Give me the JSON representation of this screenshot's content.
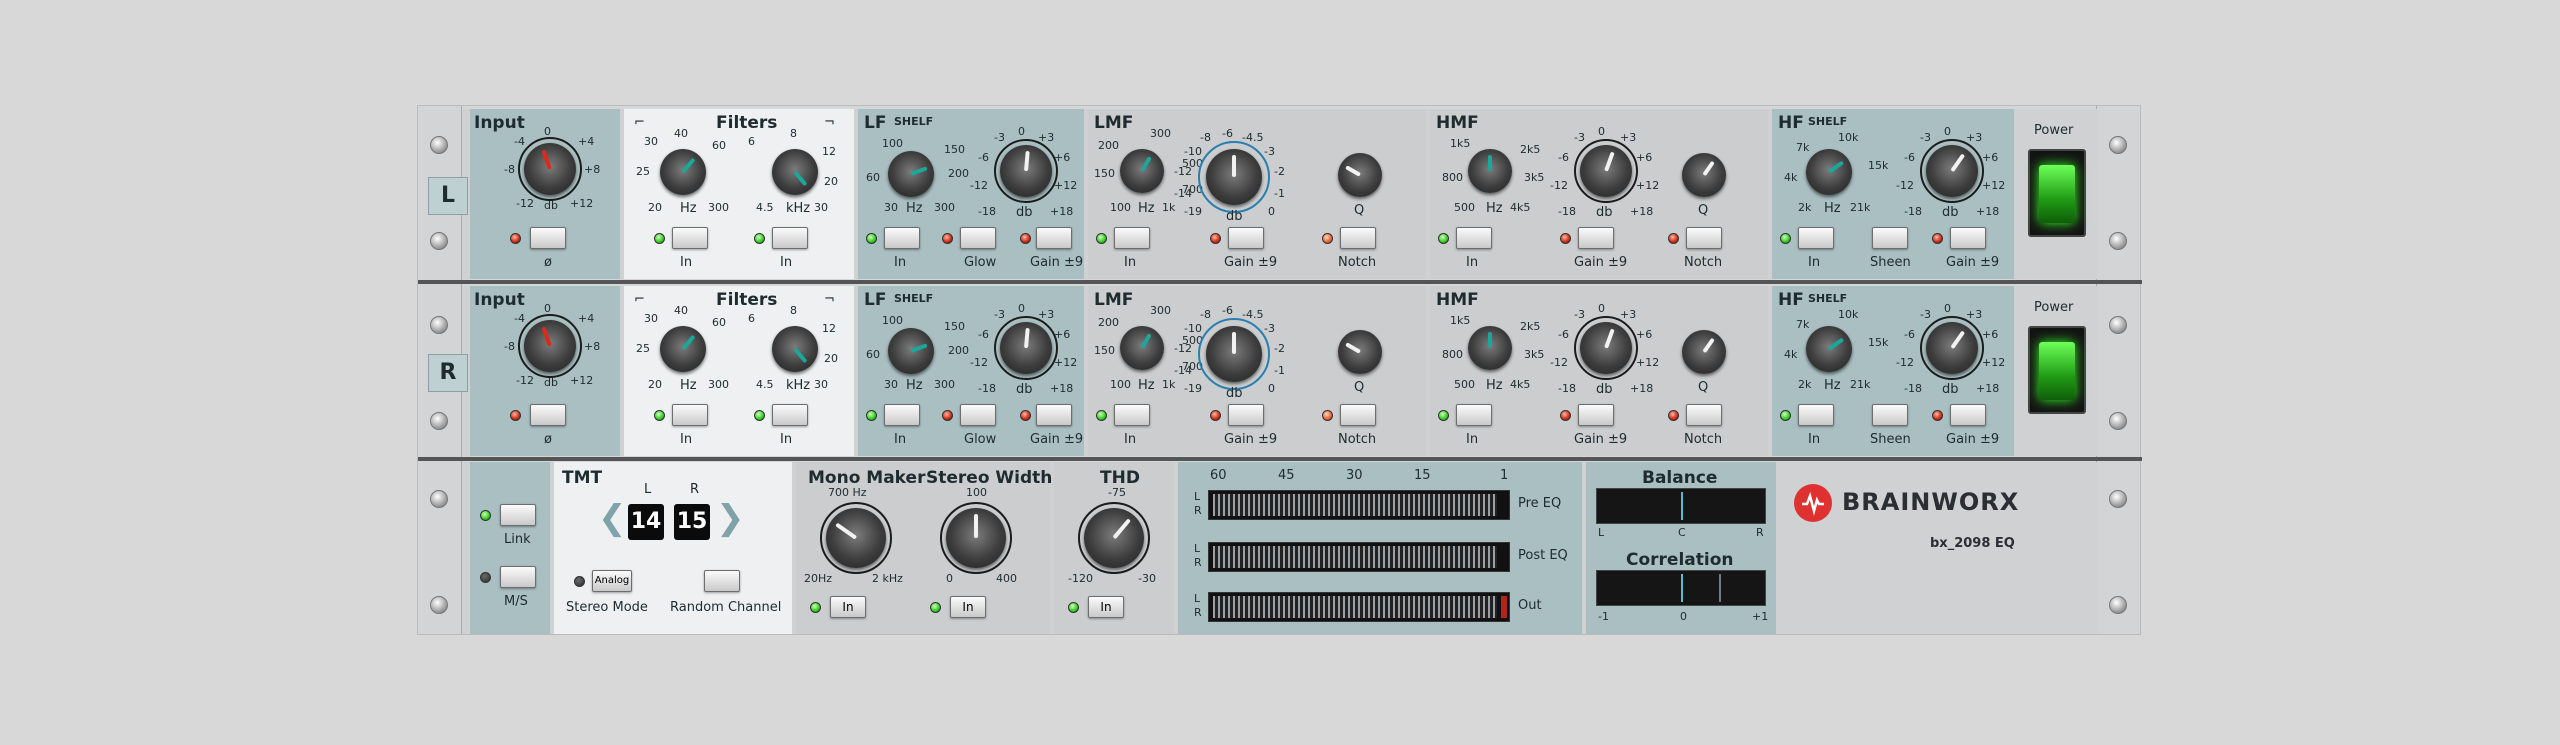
{
  "channels": [
    {
      "tag": "L",
      "input": {
        "title": "Input",
        "scale": [
          "0",
          "-4",
          "+4",
          "-8",
          "+8",
          "-12",
          "+12"
        ],
        "unit": "db",
        "phase_label": "ø"
      },
      "filters": {
        "title": "Filters",
        "hp_scale": [
          "30",
          "40",
          "25",
          "60",
          "20",
          "300"
        ],
        "hp_unit": "Hz",
        "lp_scale": [
          "6",
          "8",
          "12",
          "20",
          "4.5",
          "30"
        ],
        "lp_unit": "kHz",
        "in_label": "In",
        "in_label2": "In"
      },
      "lf": {
        "title": "LF",
        "shelf": "SHELF",
        "freq_scale": [
          "100",
          "150",
          "60",
          "200",
          "30",
          "300"
        ],
        "freq_unit": "Hz",
        "gain_scale": [
          "0",
          "-3",
          "+3",
          "-6",
          "+6",
          "-12",
          "+12",
          "-18",
          "+18"
        ],
        "gain_unit": "db",
        "in_label": "In",
        "glow_label": "Glow",
        "gain_label": "Gain ±9"
      },
      "lmf": {
        "title": "LMF",
        "freq_scale": [
          "300",
          "200",
          "500",
          "150",
          "700",
          "100",
          "1k"
        ],
        "freq_unit": "Hz",
        "gain_scale": [
          "-6",
          "-8",
          "-4.5",
          "-10",
          "-3",
          "-12",
          "-2",
          "-14",
          "-1",
          "-19",
          "0"
        ],
        "gain_unit": "db",
        "q_label": "Q",
        "in_label": "In",
        "gain_label": "Gain ±9",
        "notch_label": "Notch"
      },
      "hmf": {
        "title": "HMF",
        "freq_scale": [
          "1k5",
          "2k5",
          "800",
          "3k5",
          "500",
          "4k5"
        ],
        "freq_unit": "Hz",
        "gain_scale": [
          "0",
          "-3",
          "+3",
          "-6",
          "+6",
          "-12",
          "+12",
          "-18",
          "+18"
        ],
        "gain_unit": "db",
        "q_label": "Q",
        "in_label": "In",
        "gain_label": "Gain ±9",
        "notch_label": "Notch"
      },
      "hf": {
        "title": "HF",
        "shelf": "SHELF",
        "freq_scale": [
          "10k",
          "7k",
          "15k",
          "4k",
          "2k",
          "21k"
        ],
        "freq_unit": "Hz",
        "gain_scale": [
          "0",
          "-3",
          "+3",
          "-6",
          "+6",
          "-12",
          "+12",
          "-18",
          "+18"
        ],
        "gain_unit": "db",
        "in_label": "In",
        "sheen_label": "Sheen",
        "gain_label": "Gain ±9"
      },
      "power_label": "Power"
    },
    {
      "tag": "R",
      "input": {
        "title": "Input",
        "scale": [
          "0",
          "-4",
          "+4",
          "-8",
          "+8",
          "-12",
          "+12"
        ],
        "unit": "db",
        "phase_label": "ø"
      },
      "filters": {
        "title": "Filters",
        "hp_scale": [
          "30",
          "40",
          "25",
          "60",
          "20",
          "300"
        ],
        "hp_unit": "Hz",
        "lp_scale": [
          "6",
          "8",
          "12",
          "20",
          "4.5",
          "30"
        ],
        "lp_unit": "kHz",
        "in_label": "In",
        "in_label2": "In"
      },
      "lf": {
        "title": "LF",
        "shelf": "SHELF",
        "freq_scale": [
          "100",
          "150",
          "60",
          "200",
          "30",
          "300"
        ],
        "freq_unit": "Hz",
        "gain_scale": [
          "0",
          "-3",
          "+3",
          "-6",
          "+6",
          "-12",
          "+12",
          "-18",
          "+18"
        ],
        "gain_unit": "db",
        "in_label": "In",
        "glow_label": "Glow",
        "gain_label": "Gain ±9"
      },
      "lmf": {
        "title": "LMF",
        "freq_scale": [
          "300",
          "200",
          "500",
          "150",
          "700",
          "100",
          "1k"
        ],
        "freq_unit": "Hz",
        "gain_scale": [
          "-6",
          "-8",
          "-4.5",
          "-10",
          "-3",
          "-12",
          "-2",
          "-14",
          "-1",
          "-19",
          "0"
        ],
        "gain_unit": "db",
        "q_label": "Q",
        "in_label": "In",
        "gain_label": "Gain ±9",
        "notch_label": "Notch"
      },
      "hmf": {
        "title": "HMF",
        "freq_scale": [
          "1k5",
          "2k5",
          "800",
          "3k5",
          "500",
          "4k5"
        ],
        "freq_unit": "Hz",
        "gain_scale": [
          "0",
          "-3",
          "+3",
          "-6",
          "+6",
          "-12",
          "+12",
          "-18",
          "+18"
        ],
        "gain_unit": "db",
        "q_label": "Q",
        "in_label": "In",
        "gain_label": "Gain ±9",
        "notch_label": "Notch"
      },
      "hf": {
        "title": "HF",
        "shelf": "SHELF",
        "freq_scale": [
          "10k",
          "7k",
          "15k",
          "4k",
          "2k",
          "21k"
        ],
        "freq_unit": "Hz",
        "gain_scale": [
          "0",
          "-3",
          "+3",
          "-6",
          "+6",
          "-12",
          "+12",
          "-18",
          "+18"
        ],
        "gain_unit": "db",
        "in_label": "In",
        "sheen_label": "Sheen",
        "gain_label": "Gain ±9"
      },
      "power_label": "Power"
    }
  ],
  "master": {
    "link_label": "Link",
    "ms_label": "M/S",
    "tmt": {
      "title": "TMT",
      "l_label": "L",
      "r_label": "R",
      "l_value": "14",
      "r_value": "15",
      "analog_label": "Analog",
      "stereo_mode_label": "Stereo Mode",
      "random_channel_label": "Random Channel"
    },
    "mono_maker": {
      "title": "Mono Maker",
      "top": "700 Hz",
      "min": "20Hz",
      "max": "2 kHz",
      "in_label": "In"
    },
    "stereo_width": {
      "title": "Stereo Width",
      "top": "100",
      "min": "0",
      "max": "400",
      "in_label": "In"
    },
    "thd": {
      "title": "THD",
      "top": "-75",
      "min": "-120",
      "max": "-30",
      "in_label": "In"
    },
    "meters": {
      "scale": [
        "60",
        "45",
        "30",
        "15",
        "1"
      ],
      "l": "L",
      "r": "R",
      "pre_eq": "Pre EQ",
      "post_eq": "Post EQ",
      "out": "Out"
    },
    "balance": {
      "title": "Balance",
      "left": "L",
      "center": "C",
      "right": "R"
    },
    "correlation": {
      "title": "Correlation",
      "left": "-1",
      "center": "0",
      "right": "+1"
    },
    "brand": "BRAINWORX",
    "product": "bx_2098 EQ"
  },
  "colors": {
    "panel_teal": "#a9bfc2",
    "panel_light": "#eef0f1",
    "panel_grey": "#cbcdce",
    "pointer_teal": "#1ba89a",
    "pointer_red": "#d92a1b",
    "pointer_white": "#f2f2f2",
    "led_green": "#3bd128",
    "led_red": "#d3321b",
    "power_green": "#38ff28",
    "brand_red": "#e03131"
  },
  "icons": [
    "screw-icon",
    "chevron-left-icon",
    "chevron-right-icon",
    "brainworx-logo-icon",
    "power-switch-icon"
  ]
}
